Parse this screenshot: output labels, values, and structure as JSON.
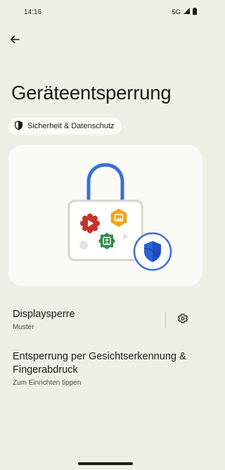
{
  "status_bar": {
    "time": "14:16",
    "network": "5G",
    "icons": [
      "signal-icon",
      "battery-icon"
    ]
  },
  "header": {
    "back_icon": "arrow-back-icon",
    "title": "Geräteentsperrung"
  },
  "chip": {
    "icon": "shield-icon",
    "label": "Sicherheit & Datenschutz"
  },
  "illustration": {
    "icons": [
      "padlock-icon",
      "play-badge-icon",
      "image-badge-icon",
      "contact-badge-icon",
      "shield-badge-icon"
    ],
    "colors": {
      "shackle": "#3a70d6",
      "play_badge": "#c5342a",
      "image_badge": "#f2a51a",
      "contact_badge": "#2f8f4a",
      "shield": "#1f4fbf"
    }
  },
  "preferences": [
    {
      "title": "Displaysperre",
      "summary": "Muster",
      "settings_icon": "gear-icon"
    },
    {
      "title": "Entsperrung per Gesichtserkennung & Fingerabdruck",
      "summary": "Zum Einrichten tippen"
    }
  ],
  "colors": {
    "background": "#eef0e6",
    "card": "#fafaf7",
    "chip": "#fbfcf6",
    "text": "#1b1c18"
  }
}
